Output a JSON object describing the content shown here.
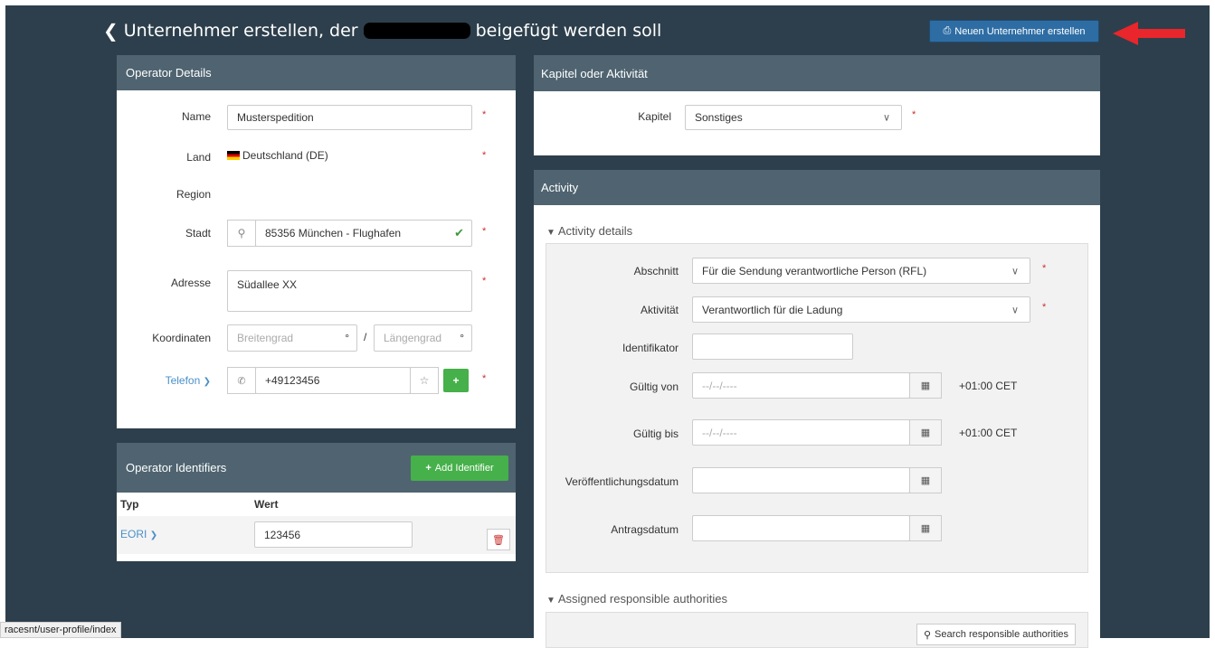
{
  "header": {
    "title_part1": "Unternehmer erstellen, der",
    "title_part2": "beigefügt werden soll",
    "new_button_label": "Neuen Unternehmer erstellen"
  },
  "operator_details": {
    "heading": "Operator Details",
    "name_label": "Name",
    "name_value": "Musterspedition",
    "land_label": "Land",
    "land_value": "Deutschland (DE)",
    "region_label": "Region",
    "stadt_label": "Stadt",
    "stadt_value": "85356 München - Flughafen",
    "adresse_label": "Adresse",
    "adresse_value": "Südallee XX",
    "koordinaten_label": "Koordinaten",
    "breitengrad_placeholder": "Breitengrad",
    "laengengrad_placeholder": "Längengrad",
    "degree": "°",
    "slash": "/",
    "telefon_label": "Telefon",
    "telefon_value": "+49123456"
  },
  "operator_identifiers": {
    "heading": "Operator Identifiers",
    "add_button_label": "Add Identifier",
    "col_typ": "Typ",
    "col_wert": "Wert",
    "rows": [
      {
        "typ": "EORI",
        "wert": "123456"
      }
    ]
  },
  "kapitel": {
    "heading": "Kapitel oder Aktivität",
    "label": "Kapitel",
    "value": "Sonstiges"
  },
  "activity": {
    "heading": "Activity",
    "details_toggle": "Activity details",
    "abschnitt_label": "Abschnitt",
    "abschnitt_value": "Für die Sendung verantwortliche Person (RFL)",
    "aktivitaet_label": "Aktivität",
    "aktivitaet_value": "Verantwortlich für die Ladung",
    "identifikator_label": "Identifikator",
    "gueltig_von_label": "Gültig von",
    "gueltig_bis_label": "Gültig bis",
    "date_placeholder": "--/--/----",
    "timezone": "+01:00 CET",
    "veroeffentlichung_label": "Veröffentlichungsdatum",
    "antragsdatum_label": "Antragsdatum",
    "authorities_toggle": "Assigned responsible authorities",
    "search_authorities_label": "Search responsible authorities"
  },
  "status_bar": {
    "url": "racesnt/user-profile/index"
  },
  "colors": {
    "background": "#2d3f4c",
    "panel_header": "#4f6470",
    "primary": "#2e6da4",
    "success": "#46b04a",
    "required": "#c9302c",
    "arrow": "#e8262b"
  }
}
